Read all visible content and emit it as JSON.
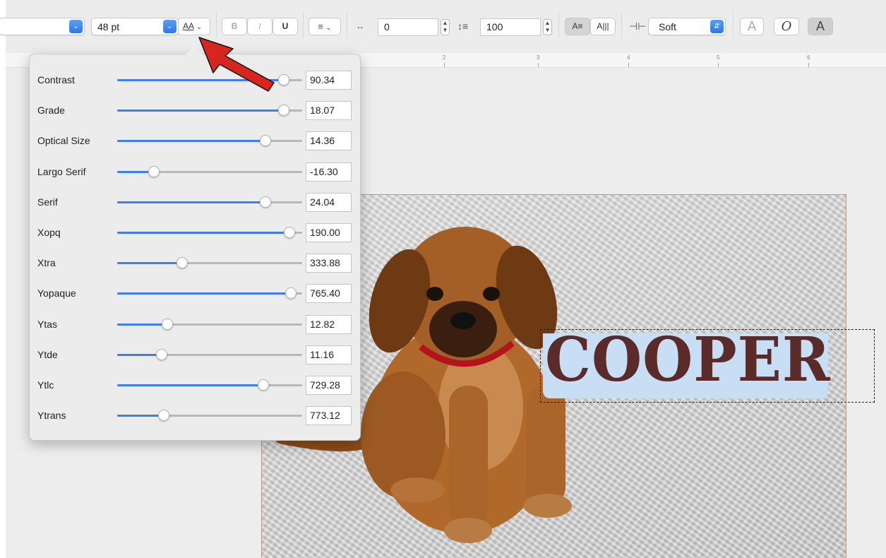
{
  "toolbar": {
    "font_size": "48 pt",
    "axes_button": "AA",
    "bold": "B",
    "italic": "I",
    "underline": "U",
    "character_spacing": "0",
    "line_spacing": "100",
    "smoothing": "Soft",
    "outline_glyph": "A",
    "oblique_glyph": "O",
    "fill_glyph": "A"
  },
  "ruler": {
    "numbers": [
      "2",
      "3",
      "4",
      "5",
      "6"
    ]
  },
  "variable_axes": [
    {
      "label": "Contrast",
      "value": "90.34",
      "fraction": 0.9
    },
    {
      "label": "Grade",
      "value": "18.07",
      "fraction": 0.9
    },
    {
      "label": "Optical Size",
      "value": "14.36",
      "fraction": 0.8
    },
    {
      "label": "Largo Serif",
      "value": "-16.30",
      "fraction": 0.2
    },
    {
      "label": "Serif",
      "value": "24.04",
      "fraction": 0.8
    },
    {
      "label": "Xopq",
      "value": "190.00",
      "fraction": 0.93
    },
    {
      "label": "Xtra",
      "value": "333.88",
      "fraction": 0.35
    },
    {
      "label": "Yopaque",
      "value": "765.40",
      "fraction": 0.94
    },
    {
      "label": "Ytas",
      "value": "12.82",
      "fraction": 0.27
    },
    {
      "label": "Ytde",
      "value": "11.16",
      "fraction": 0.24
    },
    {
      "label": "Ytlc",
      "value": "729.28",
      "fraction": 0.79
    },
    {
      "label": "Ytrans",
      "value": "773.12",
      "fraction": 0.25
    }
  ],
  "canvas": {
    "text": "COOPER"
  },
  "colors": {
    "accent": "#3f7ef0",
    "text_color": "#5a2b28",
    "highlight": "#c7def5",
    "arrow": "#d7261e"
  }
}
